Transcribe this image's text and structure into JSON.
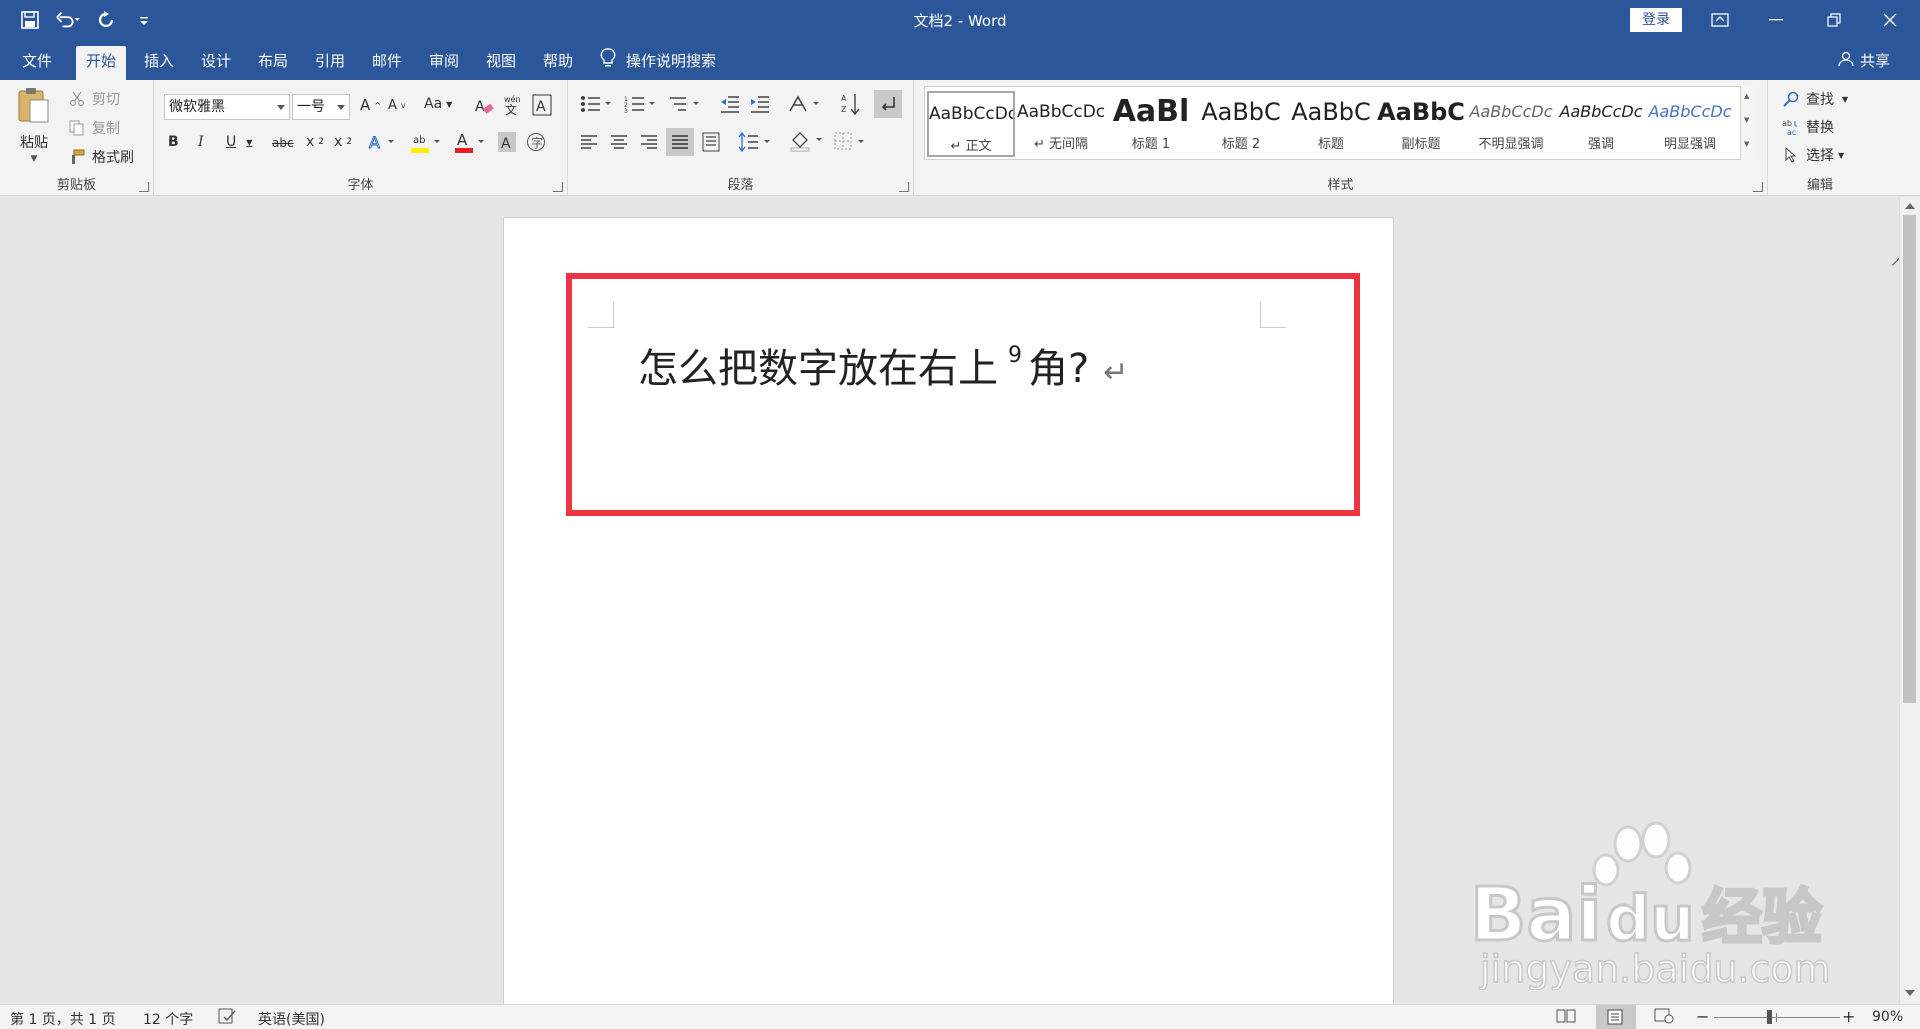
{
  "window": {
    "title": "文档2  -  Word",
    "login_label": "登录"
  },
  "quick_access": {
    "items": [
      "save-icon",
      "undo-icon",
      "redo-icon",
      "customize-icon"
    ]
  },
  "tabs": [
    {
      "label": "文件"
    },
    {
      "label": "开始"
    },
    {
      "label": "插入"
    },
    {
      "label": "设计"
    },
    {
      "label": "布局"
    },
    {
      "label": "引用"
    },
    {
      "label": "邮件"
    },
    {
      "label": "审阅"
    },
    {
      "label": "视图"
    },
    {
      "label": "帮助"
    }
  ],
  "tell_me": "操作说明搜索",
  "share_label": "共享",
  "clipboard": {
    "paste": "粘贴",
    "cut": "剪切",
    "copy": "复制",
    "format_painter": "格式刷",
    "group_label": "剪贴板"
  },
  "font": {
    "name": "微软雅黑",
    "size": "一号",
    "change_case": "Aa",
    "group_label": "字体"
  },
  "paragraph": {
    "group_label": "段落"
  },
  "styles": {
    "group_label": "样式",
    "items": [
      {
        "sample": "AaBbCcDc",
        "name": "↵ 正文"
      },
      {
        "sample": "AaBbCcDc",
        "name": "↵ 无间隔"
      },
      {
        "sample": "AaBl",
        "name": "标题 1"
      },
      {
        "sample": "AaBbC",
        "name": "标题 2"
      },
      {
        "sample": "AaBbC",
        "name": "标题"
      },
      {
        "sample": "AaBbC",
        "name": "副标题"
      },
      {
        "sample": "AaBbCcDc",
        "name": "不明显强调"
      },
      {
        "sample": "AaBbCcDc",
        "name": "强调"
      },
      {
        "sample": "AaBbCcDc",
        "name": "明显强调"
      }
    ]
  },
  "editing": {
    "find": "查找",
    "replace": "替换",
    "select": "选择",
    "group_label": "编辑"
  },
  "document": {
    "text_before": "怎么把数字放在右上",
    "superscript": "9",
    "text_after": "角?"
  },
  "status": {
    "page": "第 1 页，共 1 页",
    "words": "12 个字",
    "language": "英语(美国)",
    "zoom": "90%",
    "zoom_level": 0.9
  },
  "watermark": {
    "brand": "Bai du 经验",
    "url": "jingyan.baidu.com"
  }
}
